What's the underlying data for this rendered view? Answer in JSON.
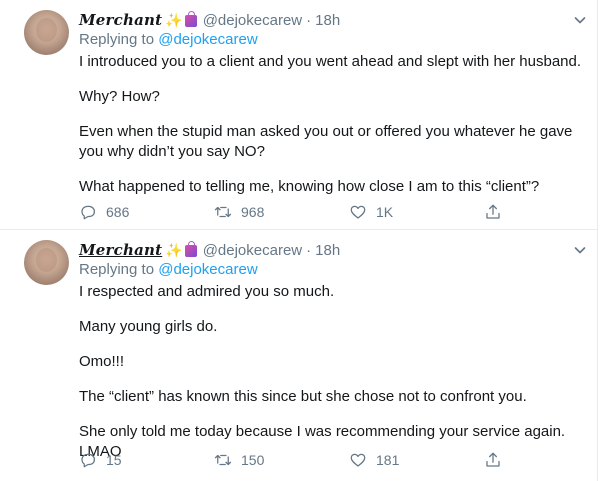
{
  "tweets": [
    {
      "name": "Merchant",
      "handle": "@dejokecarew",
      "separator": "·",
      "time": "18h",
      "replying_prefix": "Replying to",
      "replying_to": "@dejokecarew",
      "paragraphs": [
        "I introduced you to a client and you went ahead and slept with her husband.",
        "Why? How?",
        "Even when the stupid man asked you  out or offered you whatever he gave you why didn’t you say NO?",
        "What happened to telling me, knowing how close I am to this “client”?"
      ],
      "replies": "686",
      "retweets": "968",
      "likes": "1K"
    },
    {
      "name": "Merchant",
      "handle": "@dejokecarew",
      "separator": "·",
      "time": "18h",
      "replying_prefix": "Replying to",
      "replying_to": "@dejokecarew",
      "paragraphs": [
        "I respected and admired you so much.",
        "Many young girls do.",
        "Omo!!!",
        "The “client” has known this since but she chose not to confront you.",
        "She only told me today because I was recommending your service again. LMAO"
      ],
      "replies": "15",
      "retweets": "150",
      "likes": "181"
    }
  ],
  "icons": {
    "sparkle": "✨",
    "shopping_bags": "shopping-bags-icon",
    "caret": "chevron-down-icon",
    "reply": "reply-icon",
    "retweet": "retweet-icon",
    "like": "heart-icon",
    "share": "share-icon"
  },
  "colors": {
    "text": "#14171a",
    "muted": "#657786",
    "link": "#1da1f2",
    "divider": "#e6ecf0"
  }
}
